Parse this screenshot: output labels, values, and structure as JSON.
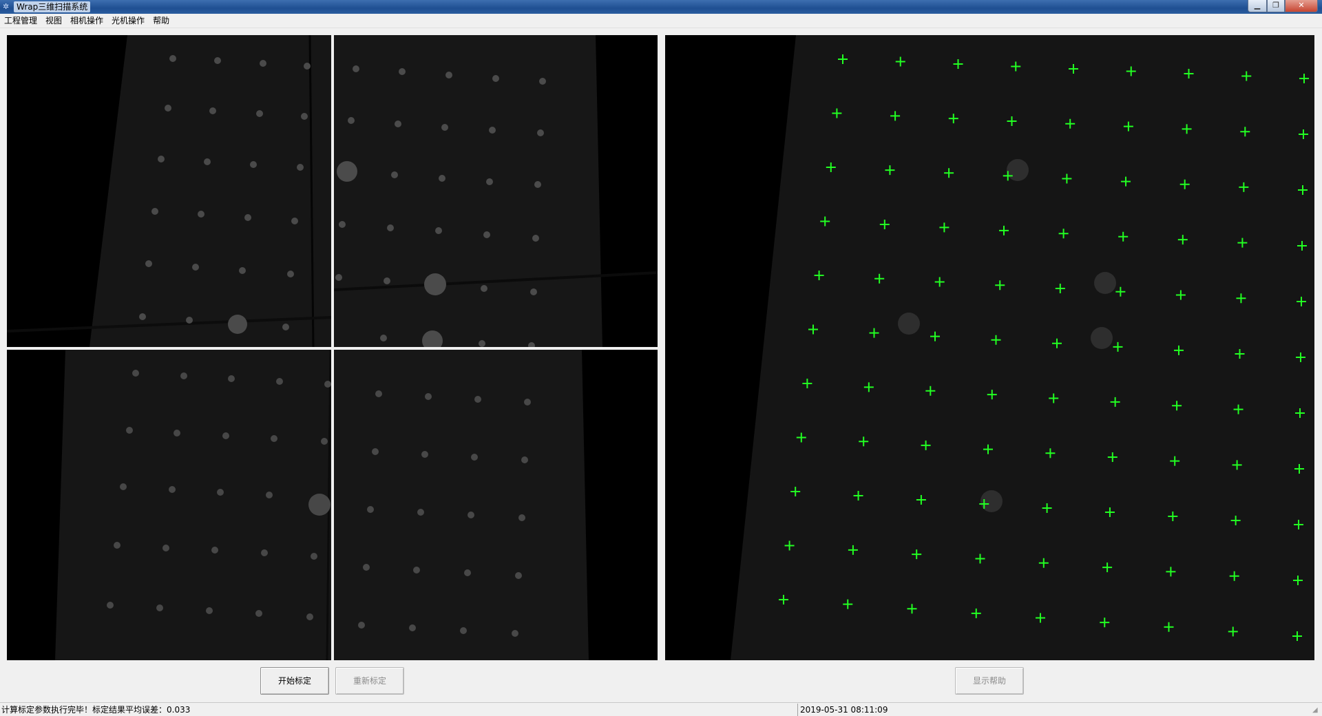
{
  "window": {
    "title": "Wrap三维扫描系统",
    "app_icon": "app-icon",
    "controls": {
      "minimize": "minimize-icon",
      "maximize": "maximize-icon",
      "close": "close-icon"
    }
  },
  "menu": [
    {
      "label": "工程管理"
    },
    {
      "label": "视图"
    },
    {
      "label": "相机操作"
    },
    {
      "label": "光机操作"
    },
    {
      "label": "帮助"
    }
  ],
  "views": {
    "camera_views": [
      "top-left",
      "top-right",
      "bottom-left",
      "bottom-right"
    ],
    "result_view": {
      "marker_color": "#22ff22",
      "detected_grid": {
        "rows": 11,
        "cols": 9
      }
    }
  },
  "buttons": {
    "start": "开始标定",
    "recalibrate": "重新标定",
    "show_help": "显示帮助"
  },
  "status": {
    "message": "计算标定参数执行完毕！标定结果平均误差：0.033",
    "datetime": "2019-05-31 08:11:09"
  }
}
